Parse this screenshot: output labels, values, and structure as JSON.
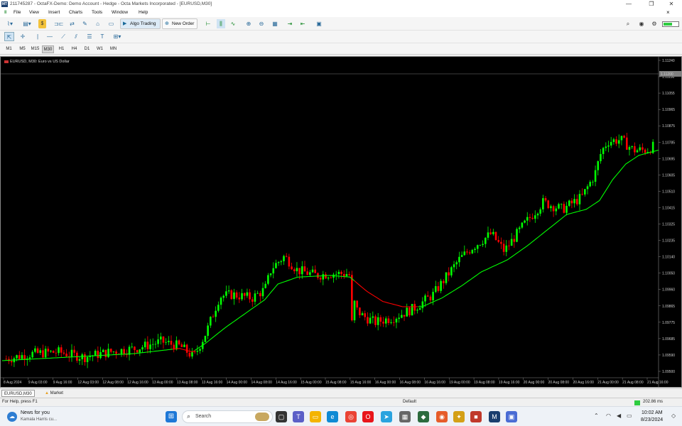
{
  "window": {
    "title": "211745287 - OctaFX-Demo: Demo Account - Hedge - Octa Markets Incorporated - [EURUSD,M30]",
    "app_icon": "MT",
    "controls": [
      "—",
      "❐",
      "✕"
    ],
    "restore_child": "×"
  },
  "menu": {
    "icon": "‖",
    "items": [
      "File",
      "View",
      "Insert",
      "Charts",
      "Tools",
      "Window",
      "Help"
    ]
  },
  "toolbar": {
    "algo_trading": "Algo Trading",
    "new_order": "New Order"
  },
  "timeframes": [
    "M1",
    "M5",
    "M15",
    "M30",
    "H1",
    "H4",
    "D1",
    "W1",
    "MN"
  ],
  "active_timeframe": "M30",
  "chart": {
    "header": "EURUSD, M30:  Euro vs US Dollar",
    "colors": {
      "bull": "#00ff00",
      "bear": "#ff0000",
      "ma_up": "#00ff00",
      "ma_down": "#ff0000",
      "current_price_bg": "#808080"
    }
  },
  "chart_data": {
    "type": "candlestick",
    "symbol": "EURUSD",
    "timeframe": "M30",
    "y_ticks": [
      "1.11240",
      "1.11150",
      "1.11055",
      "1.10965",
      "1.10875",
      "1.10785",
      "1.10695",
      "1.10605",
      "1.10510",
      "1.10415",
      "1.10325",
      "1.10235",
      "1.10140",
      "1.10050",
      "1.09960",
      "1.09865",
      "1.09775",
      "1.09685",
      "1.09590",
      "1.09500"
    ],
    "current_price": "1.11200",
    "ylim": [
      1.0946,
      1.1128
    ],
    "x_labels": [
      "8 Aug 2024",
      "9 Aug 03:00",
      "9 Aug 16:00",
      "12 Aug 03:00",
      "12 Aug 08:00",
      "12 Aug 16:00",
      "13 Aug 00:00",
      "13 Aug 08:00",
      "13 Aug 16:00",
      "14 Aug 00:00",
      "14 Aug 08:00",
      "14 Aug 16:00",
      "15 Aug 00:00",
      "15 Aug 08:00",
      "15 Aug 16:00",
      "16 Aug 00:00",
      "16 Aug 08:00",
      "16 Aug 16:00",
      "19 Aug 00:00",
      "19 Aug 08:00",
      "19 Aug 16:00",
      "20 Aug 00:00",
      "20 Aug 08:00",
      "20 Aug 16:00",
      "21 Aug 00:00",
      "21 Aug 08:00",
      "21 Aug 16:00"
    ],
    "price_path": [
      [
        0,
        1.0956
      ],
      [
        0.04,
        1.0959
      ],
      [
        0.08,
        1.096
      ],
      [
        0.12,
        1.0957
      ],
      [
        0.16,
        1.096
      ],
      [
        0.2,
        1.0962
      ],
      [
        0.24,
        1.0966
      ],
      [
        0.27,
        1.0963
      ],
      [
        0.29,
        1.0957
      ],
      [
        0.31,
        1.0972
      ],
      [
        0.33,
        1.0992
      ],
      [
        0.35,
        1.0993
      ],
      [
        0.38,
        1.0991
      ],
      [
        0.4,
        1.0996
      ],
      [
        0.41,
        1.1008
      ],
      [
        0.43,
        1.1015
      ],
      [
        0.45,
        1.1007
      ],
      [
        0.48,
        1.1004
      ],
      [
        0.5,
        1.1005
      ],
      [
        0.53,
        1.1005
      ],
      [
        0.54,
        1.0985
      ],
      [
        0.55,
        1.0981
      ],
      [
        0.57,
        1.0977
      ],
      [
        0.6,
        1.098
      ],
      [
        0.63,
        1.0985
      ],
      [
        0.66,
        1.0993
      ],
      [
        0.68,
        1.1003
      ],
      [
        0.7,
        1.1013
      ],
      [
        0.72,
        1.102
      ],
      [
        0.75,
        1.1028
      ],
      [
        0.77,
        1.1018
      ],
      [
        0.8,
        1.1033
      ],
      [
        0.83,
        1.1046
      ],
      [
        0.86,
        1.1042
      ],
      [
        0.89,
        1.1049
      ],
      [
        0.91,
        1.1062
      ],
      [
        0.92,
        1.1075
      ],
      [
        0.93,
        1.1081
      ],
      [
        0.95,
        1.1082
      ],
      [
        0.97,
        1.1076
      ],
      [
        0.99,
        1.1076
      ],
      [
        1.0,
        1.1078
      ]
    ],
    "ma_path": [
      [
        0,
        1.0955
      ],
      [
        0.1,
        1.0957
      ],
      [
        0.2,
        1.0959
      ],
      [
        0.27,
        1.0962
      ],
      [
        0.29,
        1.096
      ],
      [
        0.31,
        1.0965
      ],
      [
        0.34,
        1.0974
      ],
      [
        0.37,
        1.0982
      ],
      [
        0.4,
        1.099
      ],
      [
        0.42,
        1.0999
      ],
      [
        0.45,
        1.1003
      ],
      [
        0.5,
        1.1004
      ],
      [
        0.53,
        1.1003
      ],
      [
        0.555,
        1.0995
      ],
      [
        0.58,
        1.0989
      ],
      [
        0.61,
        1.0986
      ],
      [
        0.64,
        1.0986
      ],
      [
        0.67,
        1.0991
      ],
      [
        0.7,
        1.0998
      ],
      [
        0.73,
        1.1006
      ],
      [
        0.77,
        1.1013
      ],
      [
        0.8,
        1.1021
      ],
      [
        0.83,
        1.103
      ],
      [
        0.86,
        1.1039
      ],
      [
        0.89,
        1.1042
      ],
      [
        0.91,
        1.1047
      ],
      [
        0.93,
        1.1059
      ],
      [
        0.95,
        1.1068
      ],
      [
        0.97,
        1.1073
      ],
      [
        1.0,
        1.1076
      ]
    ],
    "ma_red_segments": [
      [
        0.26,
        0.29
      ],
      [
        0.535,
        0.63
      ]
    ],
    "grid": false
  },
  "tabs": {
    "chart_tab": "EURUSD,M30",
    "market_tab": "Market"
  },
  "status": {
    "help": "For Help, press F1",
    "profile": "Default",
    "ping": "202.86 ms"
  },
  "taskbar": {
    "news_title": "News for you",
    "news_sub": "Kamala Harris cu...",
    "search_placeholder": "Search",
    "time": "10:02 AM",
    "date": "8/23/2024"
  }
}
